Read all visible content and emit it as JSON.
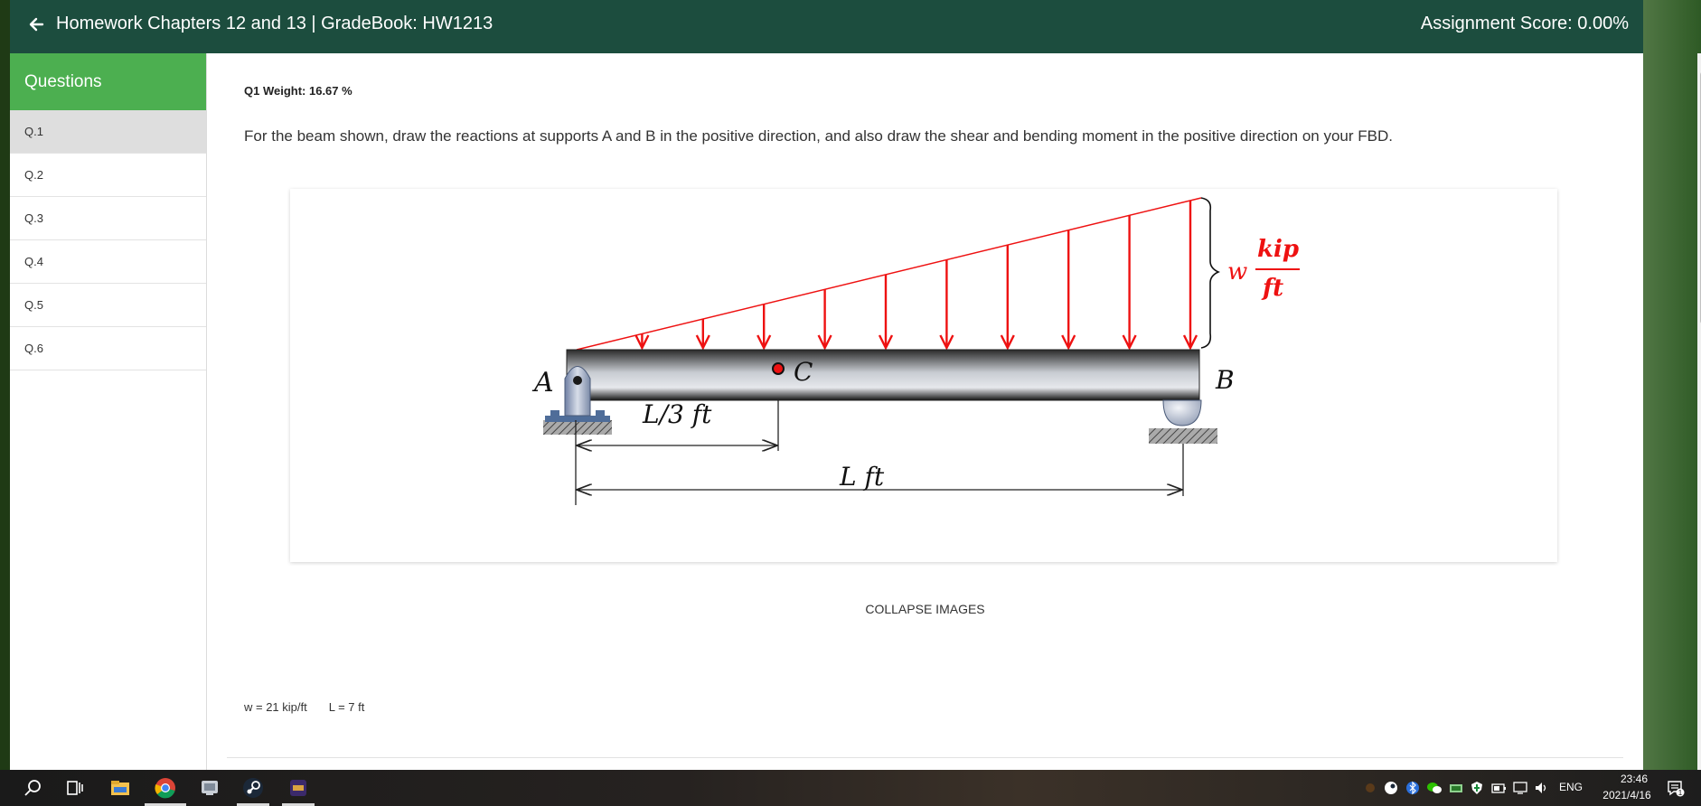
{
  "header": {
    "title": "Homework Chapters 12 and 13 | GradeBook: HW1213",
    "score": "Assignment Score: 0.00%"
  },
  "sidebar": {
    "title": "Questions",
    "items": [
      {
        "label": "Q.1",
        "active": true
      },
      {
        "label": "Q.2",
        "active": false
      },
      {
        "label": "Q.3",
        "active": false
      },
      {
        "label": "Q.4",
        "active": false
      },
      {
        "label": "Q.5",
        "active": false
      },
      {
        "label": "Q.6",
        "active": false
      }
    ]
  },
  "question": {
    "weight": "Q1 Weight: 16.67 %",
    "prompt": "For the beam shown, draw the reactions at supports A and B in the positive direction, and also draw the shear and bending moment in the positive direction on your FBD.",
    "collapse_label": "COLLAPSE IMAGES",
    "variables": [
      "w = 21 kip/ft",
      "L = 7 ft"
    ]
  },
  "figure": {
    "support_a": "A",
    "support_b": "B",
    "point_c": "C",
    "load_w": "w",
    "load_unit_num": "kip",
    "load_unit_den": "ft",
    "dim_short": "L/3 ft",
    "dim_long": "L ft",
    "colors": {
      "load": "#ee1111",
      "beam_dark": "#2a2a2a",
      "beam_light": "#e6e8ec"
    }
  },
  "taskbar": {
    "icons": [
      "search-icon",
      "task-view-icon",
      "file-explorer-icon",
      "chrome-icon",
      "app-icon",
      "steam-icon",
      "game-icon"
    ],
    "language": "ENG",
    "time": "23:46",
    "date": "2021/4/16",
    "notification_count": "1"
  }
}
